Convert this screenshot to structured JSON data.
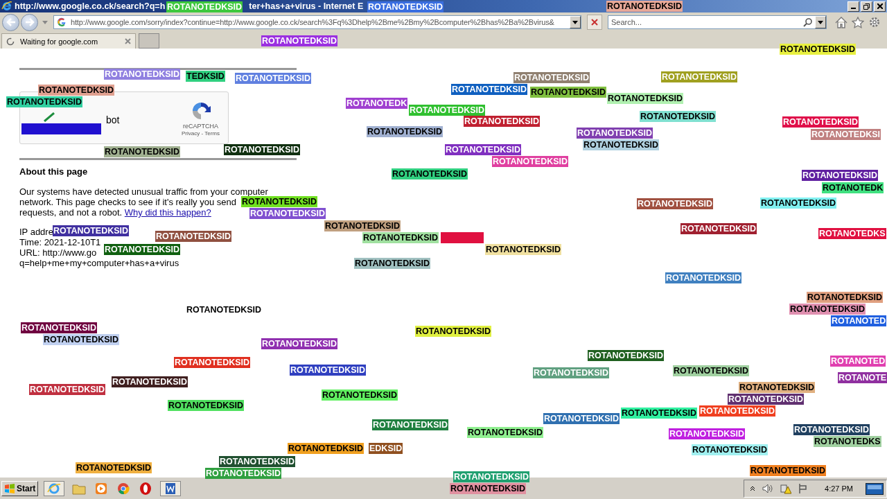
{
  "window": {
    "title_parts": [
      "http://www.google.co.ck/search?q=h",
      "ter+has+a+virus - Internet E"
    ]
  },
  "address_bar": {
    "value": "http://www.google.com/sorry/index?continue=http://www.google.co.ck/search%3Fq%3Dhelp%2Bme%2Bmy%2Bcomputer%2Bhas%2Ba%2Bvirus&"
  },
  "search": {
    "placeholder": "Search..."
  },
  "tabs": [
    {
      "label": "Waiting for google.com",
      "selected": true
    }
  ],
  "page": {
    "captcha": {
      "checkbox_label": "bot",
      "checked": true,
      "brand": "reCAPTCHA",
      "links": "Privacy - Terms"
    },
    "heading": "About this page",
    "paragraph_lines": [
      "Our systems have detected unusual traffic from your computer",
      "network. This page checks to see if it's really you send",
      "requests, and not a robot."
    ],
    "link": "Why did this happen?",
    "details": [
      "IP addre",
      "Time: 2021-12-10T1",
      "URL: http://www.go",
      "q=help+me+my+computer+has+a+virus"
    ]
  },
  "overlays": [
    {
      "kind": "label",
      "text": "ROTANOTEDKSID",
      "color": "#3ec83e"
    },
    {
      "kind": "label",
      "text": "ROTANOTEDKSID",
      "color": "#3a6ee0"
    },
    {
      "kind": "label",
      "text": "ROTANOTEDKSID",
      "color": "#e8a898"
    },
    {
      "kind": "label",
      "text": "ROTANOTEDKSID",
      "color": "#9b30e0"
    },
    {
      "kind": "label",
      "text": "ROTANOTEDKSID",
      "color": "#e8f040"
    },
    {
      "kind": "label",
      "text": "ROTANOTEDKSID",
      "color": "#9080e0"
    },
    {
      "kind": "label",
      "text": "TEDKSID",
      "color": "#30d080"
    },
    {
      "kind": "label",
      "text": "ROTANOTEDKSID",
      "color": "#6080e0"
    },
    {
      "kind": "label",
      "text": "ROTANOTEDKSID",
      "color": "#908070"
    },
    {
      "kind": "label",
      "text": "ROTANOTEDKSID",
      "color": "#a0a020"
    },
    {
      "kind": "label",
      "text": "ROTANOTEDKSID",
      "color": "#e0a090"
    },
    {
      "kind": "label",
      "text": "ROTANOTEDKSID",
      "color": "#1060c0"
    },
    {
      "kind": "label",
      "text": "ROTANOTEDKSID",
      "color": "#80c040"
    },
    {
      "kind": "label",
      "text": "ROTANOTEDKSID",
      "color": "#30d0a0"
    },
    {
      "kind": "label",
      "text": "ROTANOTEDKSID",
      "color": "#b0f0b0"
    },
    {
      "kind": "label",
      "text": "ROTANOTEDK",
      "color": "#a040d0"
    },
    {
      "kind": "label",
      "text": "ROTANOTEDKSID",
      "color": "#30c030"
    },
    {
      "kind": "label",
      "text": "ROTANOTEDKSID",
      "color": "#80e0d0"
    },
    {
      "kind": "label",
      "text": "ROTANOTEDKSID",
      "color": "#c02030"
    },
    {
      "kind": "label",
      "text": "ROTANOTEDKSID",
      "color": "#e0104a"
    },
    {
      "kind": "label",
      "text": "ROTANOTEDKSI",
      "color": "#c08080"
    },
    {
      "kind": "label",
      "text": "ROTANOTEDKSID",
      "color": "#a0b0d0"
    },
    {
      "kind": "label",
      "text": "ROTANOTEDKSID",
      "color": "#8040b0"
    },
    {
      "kind": "label",
      "text": "ROTANOTEDKSID",
      "color": "#b0d0e0"
    },
    {
      "kind": "label",
      "text": "ROTANOTEDKSID",
      "color": "#a0b090"
    },
    {
      "kind": "label",
      "text": "ROTANOTEDKSID",
      "color": "#103010"
    },
    {
      "kind": "label",
      "text": "ROTANOTEDKSID",
      "color": "#8030c0"
    },
    {
      "kind": "label",
      "text": "ROTANOTEDKSID",
      "color": "#e040a0"
    },
    {
      "kind": "label",
      "text": "ROTANOTEDKSID",
      "color": "#30d080"
    },
    {
      "kind": "label",
      "text": "ROTANOTEDKSID",
      "color": "#6020a0"
    },
    {
      "kind": "label",
      "text": "ROTANOTEDK",
      "color": "#40e080"
    },
    {
      "kind": "label",
      "text": "ROTANOTEDKSID",
      "color": "#70e020"
    },
    {
      "kind": "label",
      "text": "ROTANOTEDKSID",
      "color": "#8050d0"
    },
    {
      "kind": "label",
      "text": "ROTANOTEDKSID",
      "color": "#a05040"
    },
    {
      "kind": "label",
      "text": "ROTANOTEDKSID",
      "color": "#80f0f0"
    },
    {
      "kind": "label",
      "text": "ROTANOTEDKSID",
      "color": "#c0a080"
    },
    {
      "kind": "label",
      "text": "ROTANOTEDKSID",
      "color": "#a02030"
    },
    {
      "kind": "label",
      "text": "ROTANOTEDKS",
      "color": "#e01040"
    },
    {
      "kind": "label",
      "text": "ROTANOTEDKSID",
      "color": "#4030a0"
    },
    {
      "kind": "label",
      "text": "ROTANOTEDKSID",
      "color": "#905040"
    },
    {
      "kind": "label",
      "text": "ROTANOTEDKSID",
      "color": "#106010"
    },
    {
      "kind": "label",
      "text": "ROTANOTEDKSID",
      "color": "#a0e0a0"
    },
    {
      "kind": "bar",
      "color": "#e01040"
    },
    {
      "kind": "label",
      "text": "ROTANOTEDKSID",
      "color": "#f0e0a0"
    },
    {
      "kind": "label",
      "text": "ROTANOTEDKSID",
      "color": "#a0c0c0"
    },
    {
      "kind": "label",
      "text": "ROTANOTEDKSID",
      "color": "#4080c0"
    },
    {
      "kind": "label",
      "text": "ROTANOTEDKSID",
      "color": "#ffffff"
    },
    {
      "kind": "label",
      "text": "ROTANOTEDKSID",
      "color": "#e0a080"
    },
    {
      "kind": "label",
      "text": "ROTANOTEDKSID",
      "color": "#e090b0"
    },
    {
      "kind": "label",
      "text": "ROTANOTED",
      "color": "#2060e0"
    },
    {
      "kind": "label",
      "text": "ROTANOTEDKSID",
      "color": "#700040"
    },
    {
      "kind": "label",
      "text": "ROTANOTEDKSID",
      "color": "#c0d0f0"
    },
    {
      "kind": "label",
      "text": "ROTANOTEDKSID",
      "color": "#e0f040"
    },
    {
      "kind": "label",
      "text": "ROTANOTEDKSID",
      "color": "#9030b0"
    },
    {
      "kind": "label",
      "text": "ROTANOTEDKSID",
      "color": "#206020"
    },
    {
      "kind": "label",
      "text": "ROTANOTEDKSID",
      "color": "#e03020"
    },
    {
      "kind": "label",
      "text": "ROTANOTED",
      "color": "#e040b0"
    },
    {
      "kind": "label",
      "text": "ROTANOTEDKSID",
      "color": "#3040c0"
    },
    {
      "kind": "label",
      "text": "ROTANOTEDKSID",
      "color": "#60a080"
    },
    {
      "kind": "label",
      "text": "ROTANOTEDKSID",
      "color": "#a0d0a0"
    },
    {
      "kind": "label",
      "text": "ROTANOTE",
      "color": "#9030a0"
    },
    {
      "kind": "label",
      "text": "ROTANOTEDKSID",
      "color": "#402020"
    },
    {
      "kind": "label",
      "text": "ROTANOTEDKSID",
      "color": "#c03040"
    },
    {
      "kind": "label",
      "text": "ROTANOTEDKSID",
      "color": "#50e060"
    },
    {
      "kind": "label",
      "text": "ROTANOTEDKSID",
      "color": "#60f060"
    },
    {
      "kind": "label",
      "text": "ROTANOTEDKSID",
      "color": "#e0b080"
    },
    {
      "kind": "label",
      "text": "ROTANOTEDKSID",
      "color": "#603070"
    },
    {
      "kind": "label",
      "text": "ROTANOTEDKSID",
      "color": "#30f0a0"
    },
    {
      "kind": "label",
      "text": "ROTANOTEDKSID",
      "color": "#f04020"
    },
    {
      "kind": "label",
      "text": "ROTANOTEDKSID",
      "color": "#3070b0"
    },
    {
      "kind": "label",
      "text": "ROTANOTEDKSID",
      "color": "#208040"
    },
    {
      "kind": "label",
      "text": "ROTANOTEDKSID",
      "color": "#90f090"
    },
    {
      "kind": "label",
      "text": "ROTANOTEDKSID",
      "color": "#c020e0"
    },
    {
      "kind": "label",
      "text": "ROTANOTEDKSID",
      "color": "#204060"
    },
    {
      "kind": "label",
      "text": "ROTANOTEDKSID",
      "color": "#f0a020"
    },
    {
      "kind": "label",
      "text": "EDKSID",
      "color": "#905020"
    },
    {
      "kind": "label",
      "text": "ROTANOTEDKSID",
      "color": "#a0f0f0"
    },
    {
      "kind": "label",
      "text": "ROTANOTEDKS",
      "color": "#a0d0a0"
    },
    {
      "kind": "label",
      "text": "ROTANOTEDKSID",
      "color": "#f0b040"
    },
    {
      "kind": "label",
      "text": "ROTANOTEDKSID",
      "color": "#205030"
    },
    {
      "kind": "label",
      "text": "ROTANOTEDKSID",
      "color": "#30a040"
    },
    {
      "kind": "label",
      "text": "ROTANOTEDKSID",
      "color": "#20a070"
    },
    {
      "kind": "label",
      "text": "ROTANOTEDKSID",
      "color": "#f08020"
    },
    {
      "kind": "label",
      "text": "ROTANOTEDKSID",
      "color": "#e090a0"
    },
    {
      "kind": "bar",
      "color": "#2010d0"
    }
  ],
  "taskbar": {
    "start": "Start",
    "clock": "4:27 PM"
  }
}
